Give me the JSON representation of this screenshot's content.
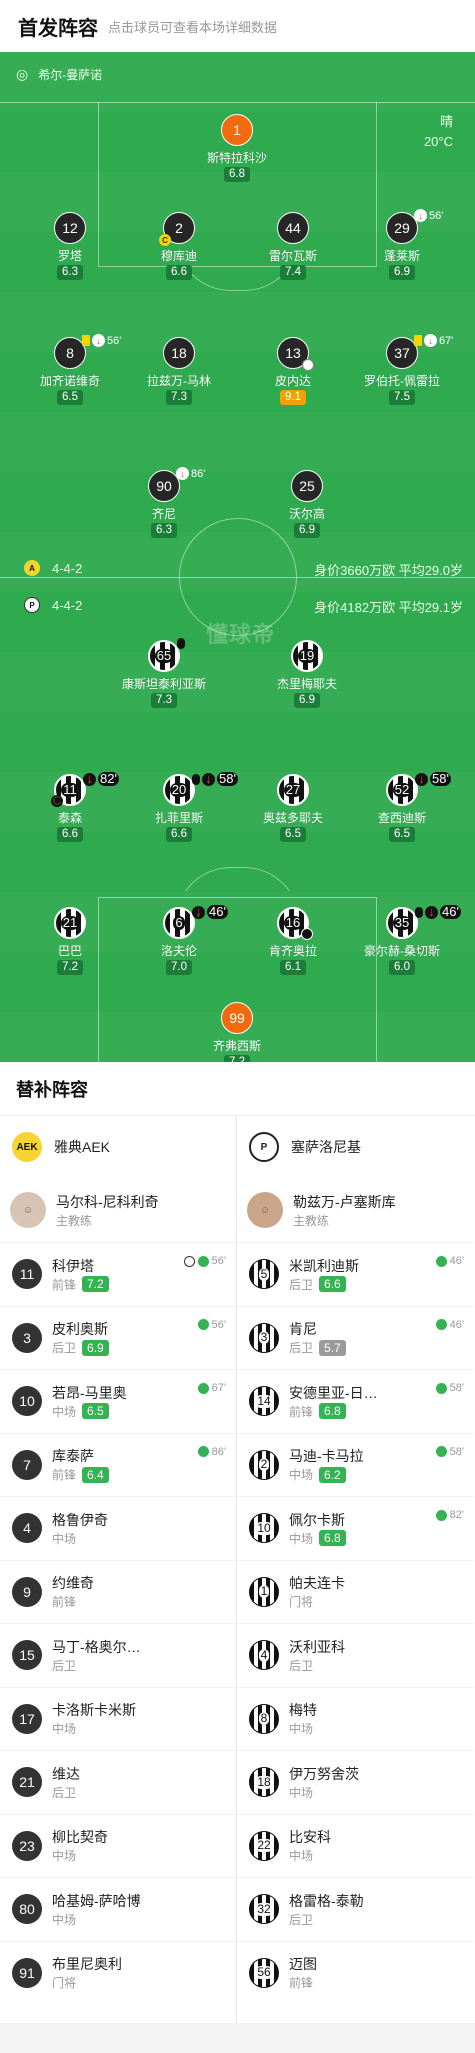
{
  "header": {
    "title": "首发阵容",
    "hint": "点击球员可查看本场详细数据"
  },
  "venue": {
    "name": "希尔-曼萨诺"
  },
  "weather": {
    "condition": "晴",
    "temperature": "20°C"
  },
  "watermark": "懂球帝",
  "home_lineup": {
    "formation": "4-4-2",
    "value": "身价3660万欧 平均29.0岁",
    "players": [
      {
        "num": "1",
        "name": "斯特拉科沙",
        "rating": "6.8",
        "gk": true
      },
      {
        "num": "12",
        "name": "罗塔",
        "rating": "6.3"
      },
      {
        "num": "2",
        "name": "穆库迪",
        "rating": "6.6",
        "captain": true
      },
      {
        "num": "44",
        "name": "雷尔瓦斯",
        "rating": "7.4"
      },
      {
        "num": "29",
        "name": "蓬莱斯",
        "rating": "6.9",
        "sub_min": "56'"
      },
      {
        "num": "8",
        "name": "加齐诺维奇",
        "rating": "6.5",
        "yellow": true,
        "sub_min": "56'"
      },
      {
        "num": "18",
        "name": "拉兹万-马林",
        "rating": "7.3"
      },
      {
        "num": "13",
        "name": "皮内达",
        "rating": "9.1",
        "best": true
      },
      {
        "num": "37",
        "name": "罗伯托-佩雷拉",
        "rating": "7.5",
        "yellow": true,
        "sub_min": "67'"
      },
      {
        "num": "90",
        "name": "齐尼",
        "rating": "6.3",
        "sub_min": "86'"
      },
      {
        "num": "25",
        "name": "沃尔高",
        "rating": "6.9"
      }
    ]
  },
  "away_lineup": {
    "formation": "4-4-2",
    "value": "身价4182万欧 平均29.1岁",
    "players": [
      {
        "num": "65",
        "name": "康斯坦泰利亚斯",
        "rating": "7.3",
        "yellow": true
      },
      {
        "num": "19",
        "name": "杰里梅耶夫",
        "rating": "6.9"
      },
      {
        "num": "11",
        "name": "泰森",
        "rating": "6.6",
        "captain": true,
        "sub_min": "82'"
      },
      {
        "num": "20",
        "name": "扎菲里斯",
        "rating": "6.6",
        "yellow": true,
        "sub_min": "58'"
      },
      {
        "num": "27",
        "name": "奥兹多耶夫",
        "rating": "6.5"
      },
      {
        "num": "52",
        "name": "查西迪斯",
        "rating": "6.5",
        "sub_min": "58'"
      },
      {
        "num": "21",
        "name": "巴巴",
        "rating": "7.2"
      },
      {
        "num": "6",
        "name": "洛夫伦",
        "rating": "7.0",
        "sub_min": "46'"
      },
      {
        "num": "16",
        "name": "肯齐奥拉",
        "rating": "6.1"
      },
      {
        "num": "35",
        "name": "豪尔赫-桑切斯",
        "rating": "6.0",
        "yellow": true,
        "sub_min": "46'"
      },
      {
        "num": "99",
        "name": "齐弗西斯",
        "rating": "7.2",
        "gk": true
      }
    ]
  },
  "subs_section": {
    "title": "替补阵容"
  },
  "home_subs": {
    "team": "雅典AEK",
    "coach": {
      "name": "马尔科-尼科利奇",
      "role": "主教练"
    },
    "list": [
      {
        "num": "11",
        "name": "科伊塔",
        "pos": "前锋",
        "rating": "7.2",
        "ev": "56'",
        "goal": true
      },
      {
        "num": "3",
        "name": "皮利奥斯",
        "pos": "后卫",
        "rating": "6.9",
        "ev": "56'"
      },
      {
        "num": "10",
        "name": "若昂-马里奥",
        "pos": "中场",
        "rating": "6.5",
        "ev": "67'"
      },
      {
        "num": "7",
        "name": "库泰萨",
        "pos": "前锋",
        "rating": "6.4",
        "ev": "86'"
      },
      {
        "num": "4",
        "name": "格鲁伊奇",
        "pos": "中场"
      },
      {
        "num": "9",
        "name": "约维奇",
        "pos": "前锋"
      },
      {
        "num": "15",
        "name": "马丁-格奥尔…",
        "pos": "后卫"
      },
      {
        "num": "17",
        "name": "卡洛斯卡米斯",
        "pos": "中场"
      },
      {
        "num": "21",
        "name": "维达",
        "pos": "后卫"
      },
      {
        "num": "23",
        "name": "柳比契奇",
        "pos": "中场"
      },
      {
        "num": "80",
        "name": "哈基姆-萨哈博",
        "pos": "中场"
      },
      {
        "num": "91",
        "name": "布里尼奥利",
        "pos": "门将"
      }
    ]
  },
  "away_subs": {
    "team": "塞萨洛尼基",
    "coach": {
      "name": "勒兹万-卢塞斯库",
      "role": "主教练"
    },
    "list": [
      {
        "num": "5",
        "name": "米凯利迪斯",
        "pos": "后卫",
        "rating": "6.6",
        "ev": "46'"
      },
      {
        "num": "3",
        "name": "肯尼",
        "pos": "后卫",
        "rating": "5.7",
        "grey": true,
        "ev": "46'"
      },
      {
        "num": "14",
        "name": "安德里亚-日…",
        "pos": "前锋",
        "rating": "6.8",
        "ev": "58'"
      },
      {
        "num": "2",
        "name": "马迪-卡马拉",
        "pos": "中场",
        "rating": "6.2",
        "ev": "58'"
      },
      {
        "num": "10",
        "name": "佩尔卡斯",
        "pos": "中场",
        "rating": "6.8",
        "ev": "82'"
      },
      {
        "num": "1",
        "name": "帕夫连卡",
        "pos": "门将"
      },
      {
        "num": "4",
        "name": "沃利亚科",
        "pos": "后卫"
      },
      {
        "num": "8",
        "name": "梅特",
        "pos": "中场"
      },
      {
        "num": "18",
        "name": "伊万努舍茨",
        "pos": "中场"
      },
      {
        "num": "22",
        "name": "比安科",
        "pos": "中场"
      },
      {
        "num": "32",
        "name": "格雷格-泰勒",
        "pos": "后卫"
      },
      {
        "num": "56",
        "name": "迈图",
        "pos": "前锋"
      }
    ]
  }
}
